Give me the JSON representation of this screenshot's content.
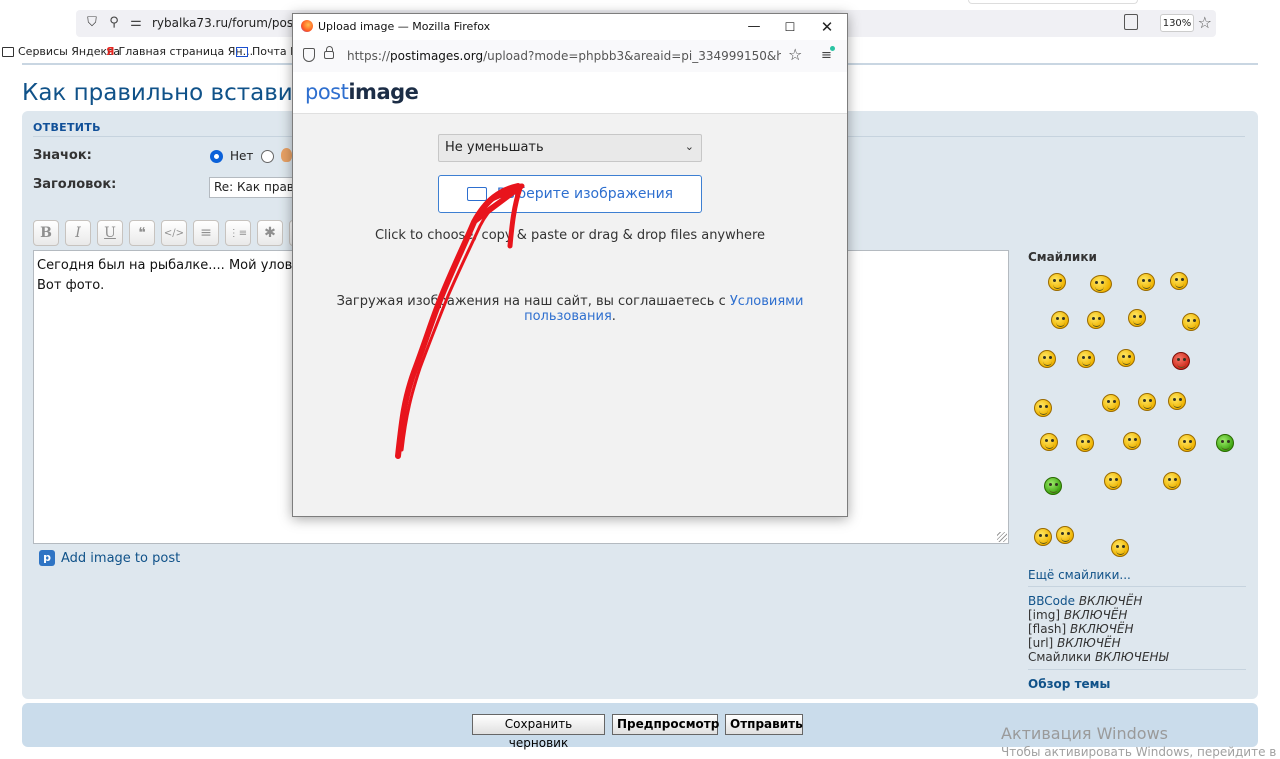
{
  "browser": {
    "url": "rybalka73.ru/forum/posting.",
    "zoom": "130%",
    "bookmarks": [
      {
        "label": "Сервисы Яндекса"
      },
      {
        "label": "Главная страница Ян..."
      },
      {
        "label": "Почта M"
      }
    ]
  },
  "page": {
    "title": "Как правильно вставить фо",
    "reply_heading": "ОТВЕТИТЬ",
    "icon_label": "Значок:",
    "icon_none_label": "Нет",
    "subject_label": "Заголовок:",
    "subject_value": "Re: Как прави",
    "toolbar": [
      "B",
      "I",
      "U",
      "❝",
      "</>",
      "≡",
      "⋮≡",
      "✱",
      "▭"
    ],
    "editor_lines": [
      "Сегодня был на рыбалке.... Мой улов 5",
      "Вот фото."
    ],
    "add_image": "Add image to post",
    "smilies_title": "Смайлики",
    "more_smilies": "Ещё смайлики...",
    "status": [
      {
        "key": "BBCode",
        "val": "ВКЛЮЧЁН"
      },
      {
        "key": "[img]",
        "val": "ВКЛЮЧЁН"
      },
      {
        "key": "[flash]",
        "val": "ВКЛЮЧЁН"
      },
      {
        "key": "[url]",
        "val": "ВКЛЮЧЁН"
      },
      {
        "key": "Смайлики",
        "val": "ВКЛЮЧЕНЫ"
      }
    ],
    "topic_review": "Обзор темы",
    "buttons": {
      "save_draft": "Сохранить черновик",
      "preview": "Предпросмотр",
      "submit": "Отправить"
    }
  },
  "windows": {
    "activate_title": "Активация Windows",
    "activate_sub": "Чтобы активировать Windows, перейдите в раздел"
  },
  "popup": {
    "title": "Upload image — Mozilla Firefox",
    "url_prefix": "https://",
    "url_host": "postimages.org",
    "url_rest": "/upload?mode=phpbb3&areaid=pi_334999150&hash=1&pm=",
    "logo_a": "post",
    "logo_b": "image",
    "resize_value": "Не уменьшать",
    "choose_label": "Выберите изображения",
    "hint": "Click to choose, copy & paste or drag & drop files anywhere",
    "terms_prefix": "Загружая изображения на наш сайт, вы соглашаетесь с ",
    "terms_link": "Условиями пользования",
    "terms_suffix": "."
  },
  "colors": {
    "forum_blue": "#105289",
    "panel_bg": "#dee7ee",
    "postimage_blue": "#2e6fcf",
    "annotation_red": "#e8141c"
  }
}
